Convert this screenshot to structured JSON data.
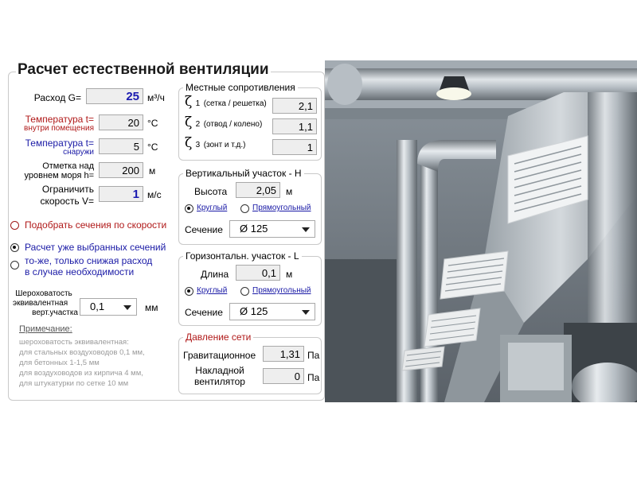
{
  "title": "Расчет естественной вентиляции",
  "flow": {
    "label": "Расход G=",
    "value": "25",
    "unit": "м³/ч"
  },
  "temp_in": {
    "label1": "Температура t=",
    "label2": "внутри помещения",
    "value": "20",
    "unit": "°C"
  },
  "temp_out": {
    "label1": "Температура t=",
    "label2": "снаружи",
    "value": "5",
    "unit": "°C"
  },
  "altitude": {
    "label1": "Отметка над",
    "label2": "уровнем моря h=",
    "value": "200",
    "unit": "м"
  },
  "speed": {
    "label1": "Ограничить",
    "label2": "скорость V=",
    "value": "1",
    "unit": "м/с"
  },
  "mode_options": [
    {
      "label": "Подобрать сечения по скорости",
      "selected": false
    },
    {
      "label": "Расчет уже выбранных сечений",
      "selected": true
    },
    {
      "label1": "то-же, только снижая расход",
      "label2": "в случае необходимости",
      "selected": false
    }
  ],
  "roughness": {
    "label1": "Шероховатость",
    "label2": "эквивалентная",
    "label3": "верт.участка",
    "value": "0,1",
    "unit": "мм"
  },
  "note": {
    "heading": "Примечание:",
    "lines": [
      "шероховатость эквивалентная:",
      "для стальных воздуховодов 0,1 мм,",
      "для бетонных 1-1,5 мм",
      "для воздуховодов из кирпича 4 мм,",
      "для штукатурки по сетке 10 мм"
    ]
  },
  "local_resist": {
    "legend": "Местные сопротивления",
    "items": [
      {
        "symbol": "ζ",
        "sub": "1",
        "desc": "(сетка / решетка)",
        "value": "2,1"
      },
      {
        "symbol": "ζ",
        "sub": "2",
        "desc": "(отвод / колено)",
        "value": "1,1"
      },
      {
        "symbol": "ζ",
        "sub": "3",
        "desc": "(зонт и т.д.)",
        "value": "1"
      }
    ]
  },
  "vertical": {
    "legend": "Вертикальный участок - H",
    "height_label": "Высота",
    "height_value": "2,05",
    "height_unit": "м",
    "round_label": "Круглый",
    "rect_label": "Прямоугольный",
    "section_label": "Сечение",
    "section_value": "Ø 125"
  },
  "horizontal": {
    "legend": "Горизонтальн. участок - L",
    "length_label": "Длина",
    "length_value": "0,1",
    "length_unit": "м",
    "round_label": "Круглый",
    "rect_label": "Прямоугольный",
    "section_label": "Сечение",
    "section_value": "Ø 125"
  },
  "pressure": {
    "legend": "Давление сети",
    "grav_label": "Гравитационное",
    "grav_value": "1,31",
    "grav_unit": "Па",
    "fan_label1": "Накладной",
    "fan_label2": "вентилятор",
    "fan_value": "0",
    "fan_unit": "Па"
  },
  "photo": {
    "description_icon": "ventilation-ducts-photo"
  },
  "colors": {
    "label_red": "#b01919",
    "label_blue": "#1a1aa6",
    "field_bg": "#eeeeee"
  }
}
